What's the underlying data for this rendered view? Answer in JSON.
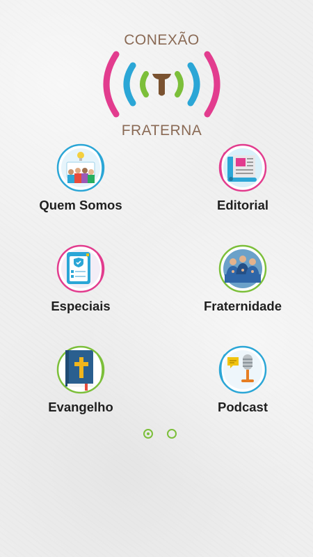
{
  "logo": {
    "line1": "CONEXÃO",
    "line2": "FRATERNA"
  },
  "tiles": [
    {
      "label": "Quem Somos",
      "icon": "team-meeting-icon",
      "ring": "#2ba6d6"
    },
    {
      "label": "Editorial",
      "icon": "open-book-icon",
      "ring": "#e23c8e"
    },
    {
      "label": "Especiais",
      "icon": "checklist-shield-icon",
      "ring": "#e23c8e"
    },
    {
      "label": "Fraternidade",
      "icon": "praying-friars-icon",
      "ring": "#7cbf3a"
    },
    {
      "label": "Evangelho",
      "icon": "bible-icon",
      "ring": "#7cbf3a"
    },
    {
      "label": "Podcast",
      "icon": "microphone-icon",
      "ring": "#2ba6d6"
    }
  ],
  "pager": {
    "pages": 2,
    "current": 1
  },
  "colors": {
    "pink": "#e23c8e",
    "blue": "#2ba6d6",
    "green": "#7cbf3a",
    "brown": "#8a6a55"
  }
}
